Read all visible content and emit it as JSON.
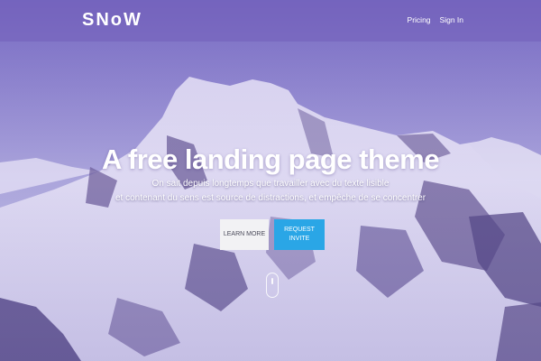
{
  "brand": {
    "logo_text": "SNoW"
  },
  "nav": {
    "items": [
      {
        "label": "Pricing"
      },
      {
        "label": "Sign In"
      }
    ]
  },
  "hero": {
    "headline": "A free landing page theme",
    "subtext_lines": [
      "On sait depuis longtemps que travailler avec du texte lisible",
      "et contenant du sens est source de distractions, et empêche de se concentrer"
    ],
    "buttons": {
      "learn_more": "LEARN MORE",
      "request_invite_lines": [
        "REQUEST",
        "INVITE"
      ]
    },
    "scroll_icon": "mouse-scroll-icon"
  },
  "colors": {
    "navbar": "#735fb9",
    "request_button": "#2aa6e6",
    "learn_button": "#f2f2f4"
  }
}
